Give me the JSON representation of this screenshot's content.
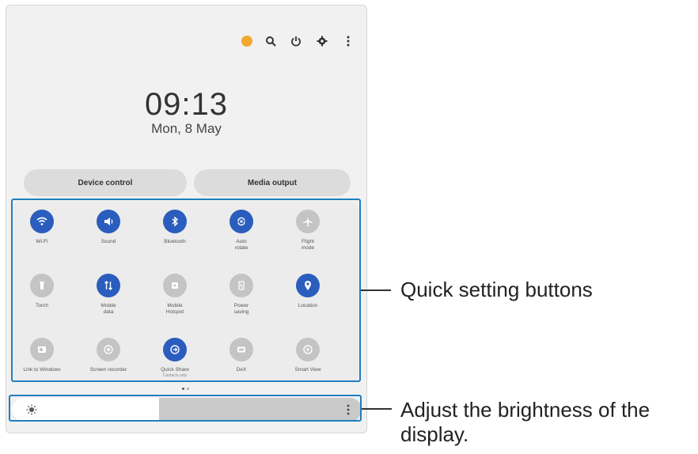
{
  "time": "09:13",
  "date": "Mon, 8 May",
  "top_icons": [
    "account-icon",
    "search-icon",
    "power-icon",
    "gear-icon",
    "more-vertical-icon"
  ],
  "buttons": {
    "device_control": "Device control",
    "media_output": "Media output"
  },
  "quick_settings": [
    {
      "label": "Wi-Fi",
      "sub": "",
      "active": true,
      "icon": "wifi-icon"
    },
    {
      "label": "Sound",
      "sub": "",
      "active": true,
      "icon": "sound-icon"
    },
    {
      "label": "Bluetooth",
      "sub": "",
      "active": true,
      "icon": "bluetooth-icon"
    },
    {
      "label": "Auto\nrotate",
      "sub": "",
      "active": true,
      "icon": "auto-rotate-icon"
    },
    {
      "label": "Flight\nmode",
      "sub": "",
      "active": false,
      "icon": "airplane-icon"
    },
    {
      "label": "Torch",
      "sub": "",
      "active": false,
      "icon": "torch-icon"
    },
    {
      "label": "Mobile\ndata",
      "sub": "",
      "active": true,
      "icon": "mobile-data-icon"
    },
    {
      "label": "Mobile\nHotspot",
      "sub": "",
      "active": false,
      "icon": "hotspot-icon"
    },
    {
      "label": "Power\nsaving",
      "sub": "",
      "active": false,
      "icon": "power-saving-icon"
    },
    {
      "label": "Location",
      "sub": "",
      "active": true,
      "icon": "location-icon"
    },
    {
      "label": "Link to Windows",
      "sub": "",
      "active": false,
      "icon": "link-to-windows-icon"
    },
    {
      "label": "Screen recorder",
      "sub": "",
      "active": false,
      "icon": "screen-recorder-icon"
    },
    {
      "label": "Quick Share",
      "sub": "Contacts only",
      "active": true,
      "icon": "quick-share-icon"
    },
    {
      "label": "DeX",
      "sub": "",
      "active": false,
      "icon": "dex-icon"
    },
    {
      "label": "Smart View",
      "sub": "",
      "active": false,
      "icon": "smart-view-icon"
    }
  ],
  "page_indicator": {
    "pages": 2,
    "current": 1
  },
  "brightness": {
    "level": 0.42
  },
  "callouts": {
    "quick_settings": "Quick setting buttons",
    "brightness": "Adjust the brightness of the\ndisplay."
  },
  "colors": {
    "accent": "#2a5dbd",
    "highlight": "#1f7fbf",
    "avatar": "#f3a92f",
    "inactive": "#c4c4c4"
  }
}
